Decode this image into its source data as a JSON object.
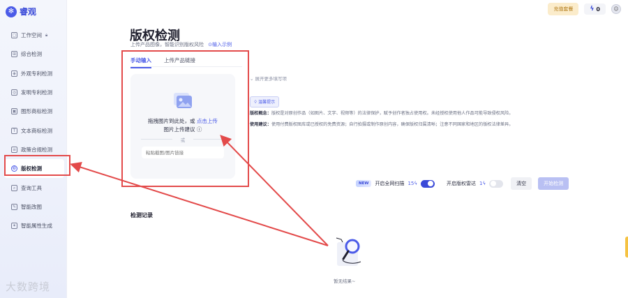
{
  "brand": {
    "name": "睿观",
    "sub": "",
    "logo_icon": "snowflake-icon"
  },
  "sidebar": {
    "items": [
      {
        "label": "工作空间",
        "icon": "workspace-icon",
        "lock": true
      },
      {
        "label": "综合检测",
        "icon": "grid-icon"
      },
      {
        "label": "外观专利检测",
        "icon": "design-patent-icon"
      },
      {
        "label": "发明专利检测",
        "icon": "invention-patent-icon"
      },
      {
        "label": "图形商标检测",
        "icon": "image-trademark-icon"
      },
      {
        "label": "文本商标检测",
        "icon": "text-trademark-icon"
      },
      {
        "label": "政策合规检测",
        "icon": "policy-icon"
      },
      {
        "label": "版权检测",
        "icon": "copyright-icon",
        "active": true
      },
      {
        "label": "查询工具",
        "icon": "search-tool-icon"
      },
      {
        "label": "智能改图",
        "icon": "image-edit-icon"
      },
      {
        "label": "智能属性生成",
        "icon": "attribute-icon"
      }
    ]
  },
  "watermark": "大数跨境",
  "topbar": {
    "recharge_label": "充值套餐",
    "energy_value": "0",
    "avatar_icon": "avatar-icon"
  },
  "page": {
    "title": "版权检测",
    "subtitle": "上传产品图像，智能识别版权风险",
    "example_link": "⊙输入示例"
  },
  "upload": {
    "tabs": [
      "手动输入",
      "上传产品链接"
    ],
    "drop_text_prefix": "拖拽图片到此处，或 ",
    "drop_text_link": "点击上传",
    "drop_text_line2": "图片上传建议 ⓘ",
    "or_label": "或",
    "paste_placeholder": "粘贴截图/图片链接"
  },
  "info": {
    "expand_label": "展开更多填写项",
    "tip_tag": "温馨提示",
    "concept_label": "版权概念：",
    "concept_text": "版权是对原创作品（如图片、文字、视频等）的法律保护，赋予创作者独占使用权。未经授权使用他人作品可能导致侵权风险。",
    "advice_label": "使用建议：",
    "advice_text": "使用付费版权图库或已授权的免费资源；自行拍摄或制作原创内容，确保版权归属清晰；注意不同国家和地区的版权法律差异。"
  },
  "controls": {
    "new_badge": "NEW",
    "full_scan_label": "开启全网扫描",
    "full_scan_cost": "15",
    "full_scan_on": true,
    "radar_label": "开启版权雷达",
    "radar_cost": "1",
    "radar_on": false,
    "clear_label": "清空",
    "start_label": "开始检测"
  },
  "records": {
    "title": "检测记录",
    "empty_text": "暂无结果~"
  },
  "colors": {
    "accent": "#4b5be8",
    "annotation": "#e34a4a"
  }
}
